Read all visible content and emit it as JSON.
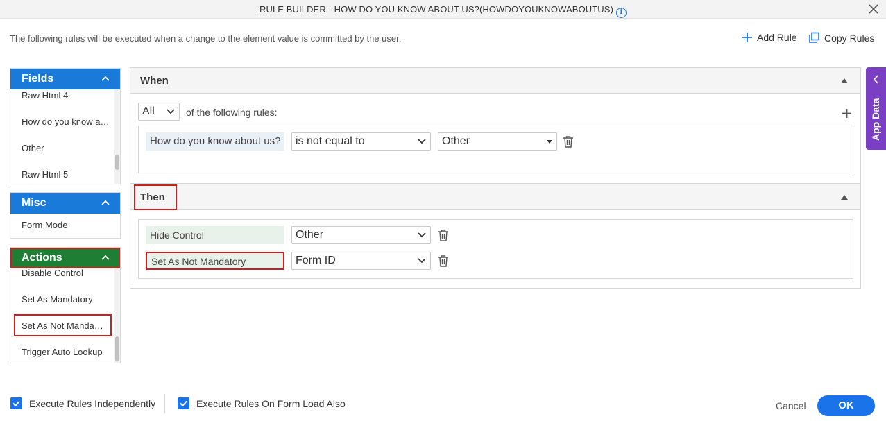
{
  "window": {
    "title": "RULE BUILDER - HOW DO YOU KNOW ABOUT US?(HOWDOYOUKNOWABOUTUS)"
  },
  "description": "The following rules will be executed when a change to the element value is committed by the user.",
  "toolbar": {
    "add_rule": "Add Rule",
    "copy_rules": "Copy Rules"
  },
  "fields_panel": {
    "title": "Fields",
    "items": [
      "Raw Html 4",
      "How do you know about us?",
      "Other",
      "Raw Html 5"
    ]
  },
  "misc_panel": {
    "title": "Misc",
    "items": [
      "Form Mode"
    ]
  },
  "actions_panel": {
    "title": "Actions",
    "items": [
      "Disable Control",
      "Set As Mandatory",
      "Set As Not Mandatory",
      "Trigger Auto Lookup"
    ]
  },
  "when": {
    "label": "When",
    "quantifier": "All",
    "quantifier_suffix": "of the following rules:",
    "condition": {
      "field": "How do you know about us?",
      "operator": "is not equal to",
      "value": "Other"
    }
  },
  "then": {
    "label": "Then",
    "actions": [
      {
        "action": "Hide Control",
        "target": "Other"
      },
      {
        "action": "Set As Not Mandatory",
        "target": "Form ID"
      }
    ]
  },
  "app_data": {
    "label": "App Data"
  },
  "footer": {
    "execute_independently": "Execute Rules Independently",
    "execute_on_load": "Execute Rules On Form Load Also",
    "cancel": "Cancel",
    "ok": "OK"
  },
  "colors": {
    "accent": "#1a73e8",
    "panel_blue": "#1a7ad9",
    "actions_green": "#1e7e34",
    "app_data_purple": "#7b3fc4",
    "highlight_red": "#cc2020"
  }
}
